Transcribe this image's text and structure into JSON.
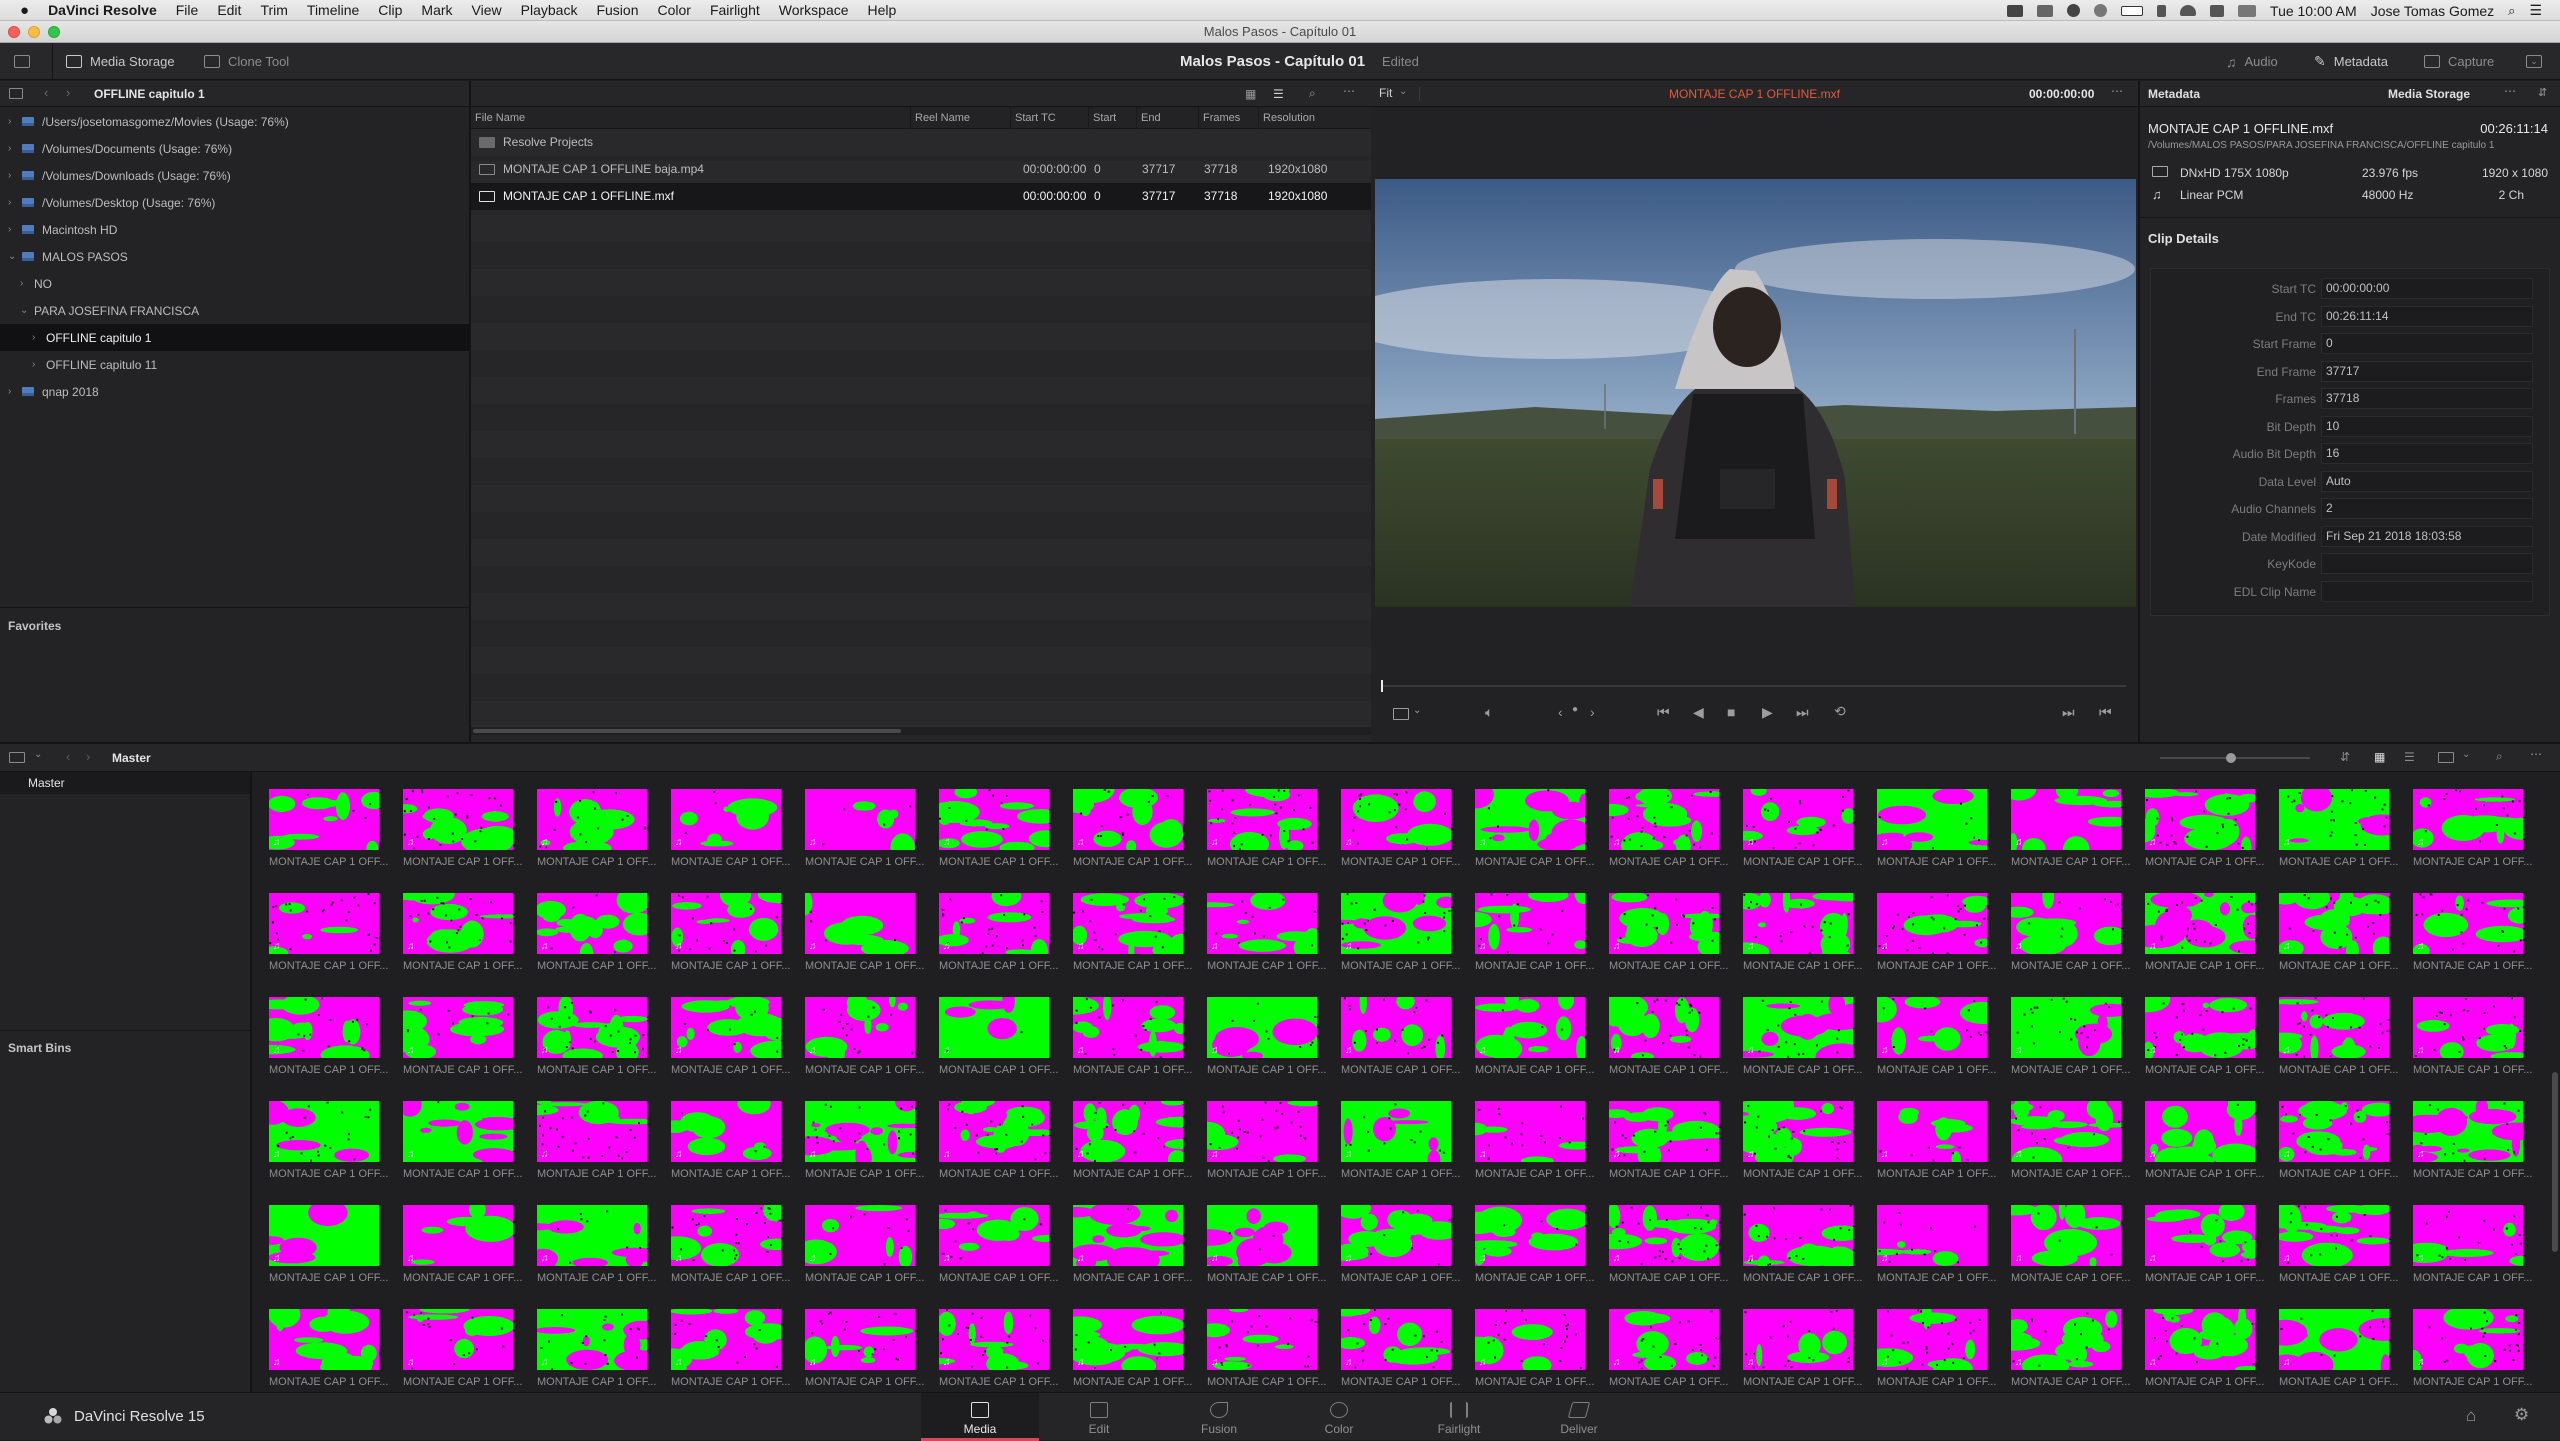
{
  "menubar": {
    "app": "DaVinci Resolve",
    "items": [
      "File",
      "Edit",
      "Trim",
      "Timeline",
      "Clip",
      "Mark",
      "View",
      "Playback",
      "Fusion",
      "Color",
      "Fairlight",
      "Workspace",
      "Help"
    ],
    "clock": "Tue 10:00 AM",
    "user": "Jose Tomas Gomez"
  },
  "window": {
    "title": "Malos Pasos - Capítulo 01"
  },
  "toolbar": {
    "media_storage": "Media Storage",
    "clone_tool": "Clone Tool",
    "project": "Malos Pasos - Capítulo 01",
    "status": "Edited",
    "audio": "Audio",
    "metadata": "Metadata",
    "capture": "Capture"
  },
  "media_storage": {
    "current_path": "OFFLINE capitulo 1",
    "tree": [
      {
        "label": "/Users/josetomasgomez/Movies (Usage: 76%)",
        "caret": "›",
        "drive": true
      },
      {
        "label": "/Volumes/Documents (Usage: 76%)",
        "caret": "›",
        "drive": true
      },
      {
        "label": "/Volumes/Downloads (Usage: 76%)",
        "caret": "›",
        "drive": true
      },
      {
        "label": "/Volumes/Desktop (Usage: 76%)",
        "caret": "›",
        "drive": true
      },
      {
        "label": "Macintosh HD",
        "caret": "›",
        "drive": true
      },
      {
        "label": "MALOS PASOS",
        "caret": "⌄",
        "drive": true
      },
      {
        "label": "NO",
        "caret": "›",
        "drive": false
      },
      {
        "label": "PARA JOSEFINA FRANCISCA",
        "caret": "⌄",
        "drive": false
      },
      {
        "label": "OFFLINE capitulo 1",
        "caret": "›",
        "drive": false,
        "selected": true
      },
      {
        "label": "OFFLINE capitulo 11",
        "caret": "›",
        "drive": false
      },
      {
        "label": "qnap 2018",
        "caret": "›",
        "drive": true
      }
    ],
    "favorites": "Favorites"
  },
  "file_list": {
    "columns": [
      "File Name",
      "Reel Name",
      "Start TC",
      "Start",
      "End",
      "Frames",
      "Resolution"
    ],
    "folder": "Resolve Projects",
    "rows": [
      {
        "name": "MONTAJE CAP 1 OFFLINE baja.mp4",
        "reel": "",
        "start_tc": "00:00:00:00",
        "start": "0",
        "end": "37717",
        "frames": "37718",
        "resolution": "1920x1080"
      },
      {
        "name": "MONTAJE CAP 1 OFFLINE.mxf",
        "reel": "",
        "start_tc": "00:00:00:00",
        "start": "0",
        "end": "37717",
        "frames": "37718",
        "resolution": "1920x1080"
      }
    ]
  },
  "viewer": {
    "zoom": "Fit",
    "clip_name": "MONTAJE CAP 1 OFFLINE.mxf",
    "timecode": "00:00:00:00",
    "playhead": 0.0
  },
  "metadata": {
    "title": "Metadata",
    "scope": "Media Storage",
    "file": "MONTAJE CAP 1 OFFLINE.mxf",
    "duration": "00:26:11:14",
    "path": "/Volumes/MALOS PASOS/PARA JOSEFINA FRANCISCA/OFFLINE capitulo 1",
    "video_codec": "DNxHD 175X 1080p",
    "fps": "23.976 fps",
    "resolution": "1920 x 1080",
    "audio_codec": "Linear PCM",
    "sample_rate": "48000 Hz",
    "channels": "2 Ch",
    "section": "Clip Details",
    "fields": [
      {
        "label": "Start TC",
        "value": "00:00:00:00"
      },
      {
        "label": "End TC",
        "value": "00:26:11:14"
      },
      {
        "label": "Start Frame",
        "value": "0"
      },
      {
        "label": "End Frame",
        "value": "37717"
      },
      {
        "label": "Frames",
        "value": "37718"
      },
      {
        "label": "Bit Depth",
        "value": "10"
      },
      {
        "label": "Audio Bit Depth",
        "value": "16"
      },
      {
        "label": "Data Level",
        "value": "Auto"
      },
      {
        "label": "Audio Channels",
        "value": "2"
      },
      {
        "label": "Date Modified",
        "value": "Fri Sep 21 2018 18:03:58"
      },
      {
        "label": "KeyKode",
        "value": ""
      },
      {
        "label": "EDL Clip Name",
        "value": ""
      }
    ]
  },
  "media_pool": {
    "bin": "Master",
    "sidebar_master": "Master",
    "smart_bins": "Smart Bins",
    "clip_caption": "MONTAJE CAP 1 OFF...",
    "colors": {
      "magenta": "#ff00ff",
      "green": "#00ff00"
    }
  },
  "pagebar": {
    "brand": "DaVinci Resolve 15",
    "pages": [
      "Media",
      "Edit",
      "Fusion",
      "Color",
      "Fairlight",
      "Deliver"
    ],
    "active": "Media"
  }
}
